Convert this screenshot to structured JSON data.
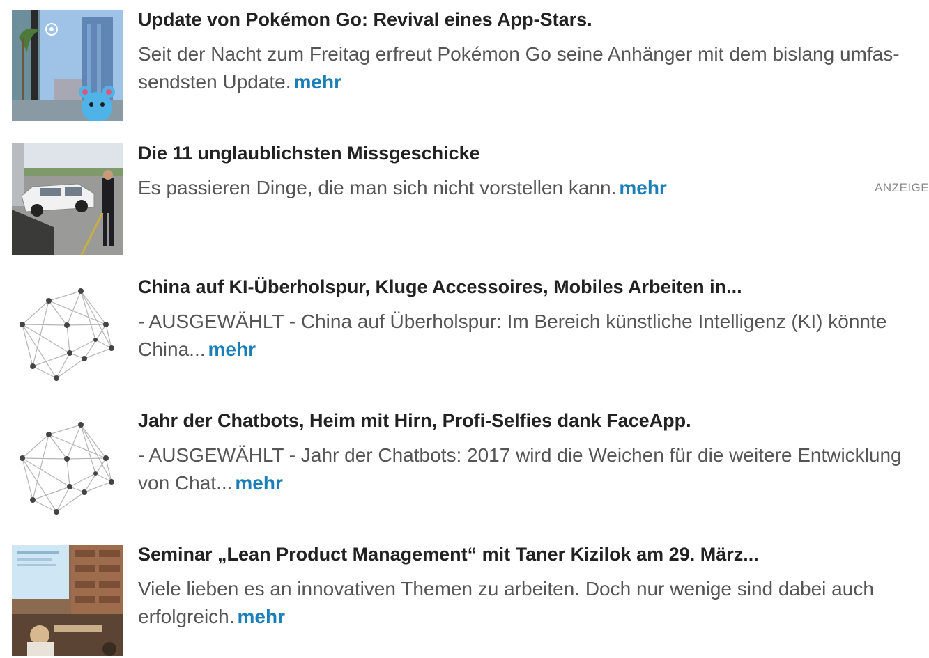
{
  "colors": {
    "title": "#222222",
    "text": "#555555",
    "link": "#1a7fb8",
    "ad_label": "#888888"
  },
  "articles": [
    {
      "thumb_icon": "pokemon-go-photo",
      "title": "Update von Pokémon Go: Revival eines App-Stars.",
      "teaser_lines": [
        "Seit der Nacht zum Freitag erfreut Pokémon Go seine Anhänger mit dem bislang umfas-",
        "sendsten Update."
      ],
      "more": "mehr"
    },
    {
      "thumb_icon": "car-accident-photo",
      "title": "Die 11 unglaublichsten Missgeschicke",
      "teaser_lines": [
        "Es passieren Dinge, die man sich nicht vorstellen kann."
      ],
      "more": "mehr",
      "ad_label": "ANZEIGE"
    },
    {
      "thumb_icon": "network-graph-icon",
      "title": "China auf KI-Überholspur, Kluge Accessoires, Mobiles Arbeiten in...",
      "teaser_lines": [
        "- AUSGEWÄHLT - China auf Überholspur: Im Bereich künstliche Intelligenz (KI) könnte",
        "China..."
      ],
      "more": "mehr"
    },
    {
      "thumb_icon": "network-graph-icon",
      "title": "Jahr der Chatbots, Heim mit Hirn, Profi-Selfies dank FaceApp.",
      "teaser_lines": [
        "- AUSGEWÄHLT - Jahr der Chatbots: 2017 wird die Weichen für die weitere Entwicklung",
        "von Chat..."
      ],
      "more": "mehr"
    },
    {
      "thumb_icon": "seminar-photo",
      "title": "Seminar „Lean Product Management“ mit Taner Kizilok am 29. März...",
      "teaser_lines": [
        "Viele lieben es an innovativen Themen zu arbeiten. Doch nur wenige sind dabei auch",
        "erfolgreich."
      ],
      "more": "mehr"
    }
  ]
}
